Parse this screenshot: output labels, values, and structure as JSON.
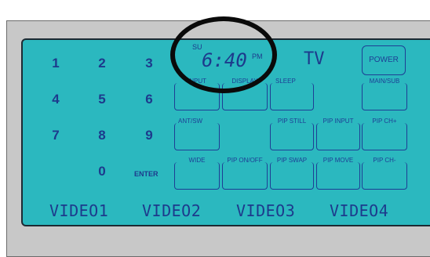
{
  "keypad": {
    "keys": [
      "1",
      "2",
      "3",
      "4",
      "5",
      "6",
      "7",
      "8",
      "9",
      "0"
    ],
    "enter": "ENTER"
  },
  "clock": {
    "day": "SU",
    "time": "6:40",
    "ampm": "PM"
  },
  "source": "TV",
  "buttons": {
    "power": "POWER",
    "input": "INPUT",
    "display": "DISPLAY",
    "sleep": "SLEEP",
    "main_sub": "MAIN/SUB",
    "ant_sw": "ANT/SW",
    "pip_still": "PIP STILL",
    "pip_input": "PIP INPUT",
    "pip_ch_plus": "PIP CH+",
    "wide": "WIDE",
    "pip_on_off": "PIP ON/OFF",
    "pip_swap": "PIP SWAP",
    "pip_move": "PIP MOVE",
    "pip_ch_minus": "PIP CH-"
  },
  "video_labels": [
    "VIDEO1",
    "VIDEO2",
    "VIDEO3",
    "VIDEO4"
  ],
  "colors": {
    "lcd": "#2bb8bf",
    "ink": "#1d3a8c",
    "annotation": "#0a0a0a"
  }
}
